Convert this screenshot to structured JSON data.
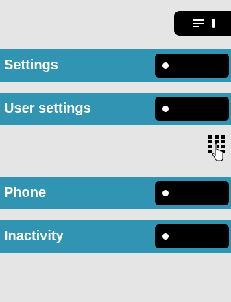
{
  "menu_key": {
    "icon": "menu-list-icon"
  },
  "items": [
    {
      "label": "Settings"
    },
    {
      "label": "User settings"
    },
    {
      "label": "Phone"
    },
    {
      "label": "Inactivity"
    }
  ],
  "keypad": {
    "icon": "keypad-press-icon"
  },
  "colors": {
    "accent": "#3094b2",
    "background": "#e5e5e5",
    "key": "#000000"
  }
}
